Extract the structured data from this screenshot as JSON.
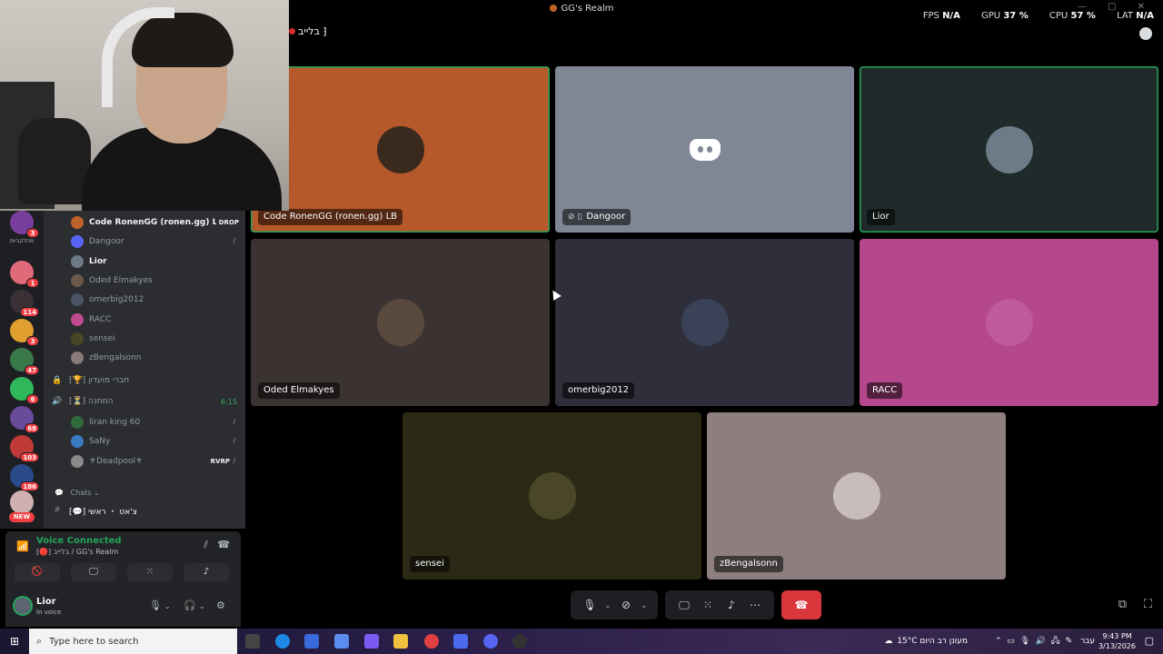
{
  "window": {
    "title": "GG's Realm",
    "stats": [
      {
        "label": "FPS",
        "value": "N/A"
      },
      {
        "label": "GPU",
        "value": "37 %"
      },
      {
        "label": "CPU",
        "value": "57 %"
      },
      {
        "label": "LAT",
        "value": "N/A"
      }
    ]
  },
  "call_header": {
    "channel": "בלייב ⁆"
  },
  "server_rail": {
    "label": "מהלקביות",
    "badges": [
      "3",
      "1",
      "114",
      "3",
      "47",
      "6",
      "68",
      "103",
      "186",
      "NEW"
    ]
  },
  "voice_members": [
    {
      "name": "Code RonenGG (ronen.gg) LB",
      "tag": "DROP",
      "color": "#c0622b",
      "bright": true,
      "icon": ""
    },
    {
      "name": "Dangoor",
      "color": "#5865f2",
      "bright": false,
      "icon": "deafened"
    },
    {
      "name": "Lior",
      "color": "#6d7a87",
      "bright": true,
      "icon": ""
    },
    {
      "name": "Oded Elmakyes",
      "color": "#6b5a4a",
      "bright": false,
      "icon": ""
    },
    {
      "name": "omerbig2012",
      "color": "#4a5466",
      "bright": false,
      "icon": ""
    },
    {
      "name": "RACC",
      "color": "#c04a8e",
      "bright": false,
      "icon": ""
    },
    {
      "name": "sensei",
      "color": "#4a4628",
      "bright": false,
      "icon": ""
    },
    {
      "name": "zBengalsonn",
      "color": "#8a7a7a",
      "bright": false,
      "icon": ""
    }
  ],
  "channels": {
    "club_channel": "⁅🏆⁆ חברי מועדון",
    "gift_channel": "⁅⏳⁆ המתנה",
    "gift_time": "6:15",
    "gift_members": [
      {
        "name": "liran king 60",
        "color": "#2f6b3a",
        "icon": "deafened"
      },
      {
        "name": "SaNy",
        "color": "#3a7ac0",
        "icon": "deafened"
      },
      {
        "name": "⚜Deadpool⚜",
        "tag": "RVRP",
        "color": "#8a8a8a",
        "icon": "deafened"
      }
    ],
    "category": "Chats",
    "text_channel": "⁅💬⁆ צ'אט ・ ראשי"
  },
  "voice_panel": {
    "status": "Voice Connected",
    "location": "⁅🔴⁆ בלייב / GG's Realm"
  },
  "user_panel": {
    "name": "Lior",
    "status": "In voice"
  },
  "tiles": [
    {
      "name": "Code RonenGG (ronen.gg) LB",
      "bg": "#b5582a",
      "avatar": "#3a2a1e",
      "speaking": true,
      "phone": false
    },
    {
      "name": "Dangoor",
      "bg": "#7f8696",
      "avatar": "",
      "speaking": false,
      "phone": true
    },
    {
      "name": "Lior",
      "bg": "#1f2a2a",
      "avatar": "#6d7a87",
      "speaking": true,
      "phone": false
    },
    {
      "name": "Oded Elmakyes",
      "bg": "#3b3332",
      "avatar": "#5a4a3e",
      "speaking": false,
      "phone": false
    },
    {
      "name": "omerbig2012",
      "bg": "#2e2f3a",
      "avatar": "#3a4258",
      "speaking": false,
      "phone": false
    },
    {
      "name": "RACC",
      "bg": "#b5478c",
      "avatar": "#c05a9e",
      "speaking": false,
      "phone": false
    },
    {
      "name": "sensei",
      "bg": "#2c2a16",
      "avatar": "#4a4628",
      "speaking": false,
      "phone": false
    },
    {
      "name": "zBengalsonn",
      "bg": "#8e7e7e",
      "avatar": "#c9bcbc",
      "speaking": false,
      "phone": false
    }
  ],
  "taskbar": {
    "search_placeholder": "Type here to search",
    "weather": "15°C  מעונן רב היום",
    "lang": "עבר",
    "time": "9:43 PM",
    "date": "3/13/2026"
  }
}
